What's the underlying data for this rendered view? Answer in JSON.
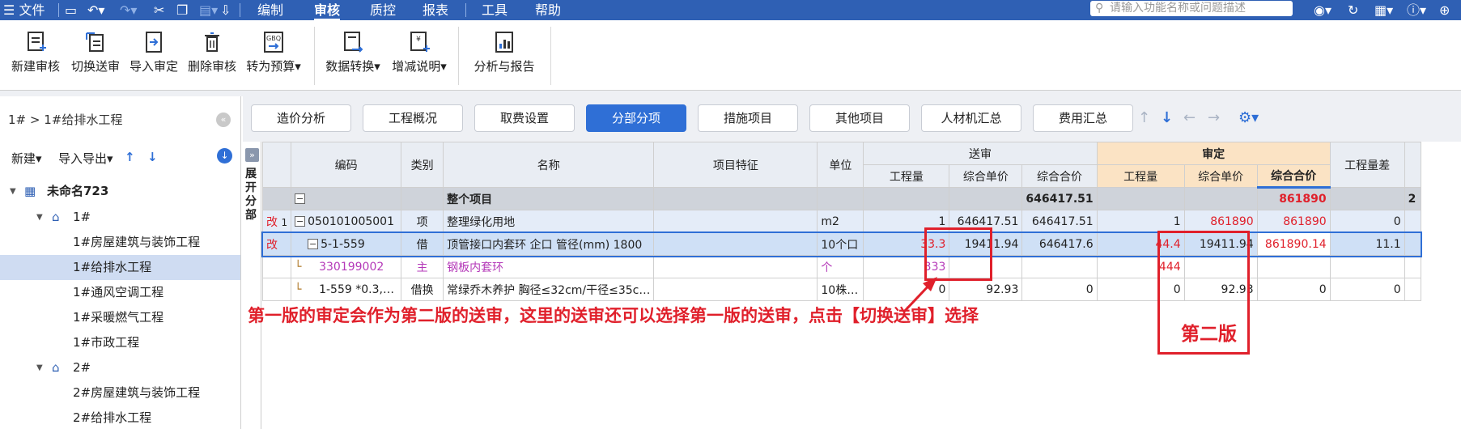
{
  "menubar": {
    "file_label": "文件",
    "items": [
      "编制",
      "审核",
      "质控",
      "报表",
      "工具",
      "帮助"
    ],
    "active": "审核",
    "search_placeholder": "请输入功能名称或问题描述"
  },
  "ribbon": {
    "buttons": [
      {
        "label": "新建审核",
        "icon": "new-audit-icon"
      },
      {
        "label": "切换送审",
        "icon": "switch-submission-icon"
      },
      {
        "label": "导入审定",
        "icon": "import-approved-icon"
      },
      {
        "label": "删除审核",
        "icon": "delete-audit-icon"
      },
      {
        "label": "转为预算",
        "icon": "convert-budget-icon"
      },
      {
        "label": "数据转换",
        "icon": "data-convert-icon"
      },
      {
        "label": "增减说明",
        "icon": "change-note-icon"
      },
      {
        "label": "分析与报告",
        "icon": "analysis-report-icon"
      }
    ]
  },
  "sidebar": {
    "breadcrumb": "1# > 1#给排水工程",
    "tools": {
      "new": "新建",
      "import_export": "导入导出"
    },
    "tree": [
      {
        "label": "未命名723",
        "level": 0,
        "type": "project",
        "expanded": true
      },
      {
        "label": "1#",
        "level": 1,
        "type": "building",
        "expanded": true
      },
      {
        "label": "1#房屋建筑与装饰工程",
        "level": 2
      },
      {
        "label": "1#给排水工程",
        "level": 2,
        "selected": true
      },
      {
        "label": "1#通风空调工程",
        "level": 2
      },
      {
        "label": "1#采暖燃气工程",
        "level": 2
      },
      {
        "label": "1#市政工程",
        "level": 2
      },
      {
        "label": "2#",
        "level": 1,
        "type": "building",
        "expanded": true
      },
      {
        "label": "2#房屋建筑与装饰工程",
        "level": 2
      },
      {
        "label": "2#给排水工程",
        "level": 2
      }
    ]
  },
  "tabs": {
    "items": [
      "造价分析",
      "工程概况",
      "取费设置",
      "分部分项",
      "措施项目",
      "其他项目",
      "人材机汇总",
      "费用汇总"
    ],
    "active": "分部分项"
  },
  "grid": {
    "side_label": "展开分部",
    "expand_label": "»",
    "headers": {
      "code": "编码",
      "type": "类别",
      "name": "名称",
      "feature": "项目特征",
      "unit": "单位",
      "submitted": "送审",
      "approved": "审定",
      "qty": "工程量",
      "unit_price": "综合单价",
      "total_price": "综合合价",
      "qty_diff": "工程量差"
    },
    "rows": [
      {
        "flag": "",
        "idx": "",
        "code": "",
        "type": "",
        "name": "整个项目",
        "unit": "",
        "s_qty": "",
        "s_price": "",
        "s_total": "646417.51",
        "a_qty": "",
        "a_price": "",
        "a_total": "861890",
        "diff": "",
        "extra": "2"
      },
      {
        "flag": "改",
        "idx": "1",
        "code": "050101005001",
        "type": "项",
        "name": "整理绿化用地",
        "unit": "m2",
        "s_qty": "1",
        "s_price": "646417.51",
        "s_total": "646417.51",
        "a_qty": "1",
        "a_price": "861890",
        "a_total": "861890",
        "diff": "0",
        "extra": ""
      },
      {
        "flag": "改",
        "idx": "",
        "code": "5-1-559",
        "type": "借",
        "name": "顶管接口内套环 企口 管径(mm) 1800",
        "unit": "10个口",
        "s_qty": "33.3",
        "s_price": "19411.94",
        "s_total": "646417.6",
        "a_qty": "44.4",
        "a_price": "19411.94",
        "a_total": "861890.14",
        "diff": "11.1",
        "extra": ""
      },
      {
        "flag": "",
        "idx": "",
        "code": "330199002",
        "type": "主",
        "name": "钢板内套环",
        "unit": "个",
        "s_qty": "333",
        "s_price": "",
        "s_total": "",
        "a_qty": "444",
        "a_price": "",
        "a_total": "",
        "diff": "",
        "extra": ""
      },
      {
        "flag": "",
        "idx": "",
        "code": "1-559 *0.3,…",
        "type": "借换",
        "name": "常绿乔木养护 胸径≤32cm/干径≤35c…",
        "unit": "10株…",
        "s_qty": "0",
        "s_price": "92.93",
        "s_total": "0",
        "a_qty": "0",
        "a_price": "92.93",
        "a_total": "0",
        "diff": "0",
        "extra": ""
      }
    ]
  },
  "annotations": {
    "main_note": "第一版的审定会作为第二版的送审，这里的送审还可以选择第一版的送审，点击【切换送审】选择",
    "version_label": "第二版"
  },
  "colors": {
    "menubar": "#2f60b4",
    "accent": "#2f6fd6",
    "annotation": "#e0202b",
    "approved_header": "#fbe3c4"
  }
}
